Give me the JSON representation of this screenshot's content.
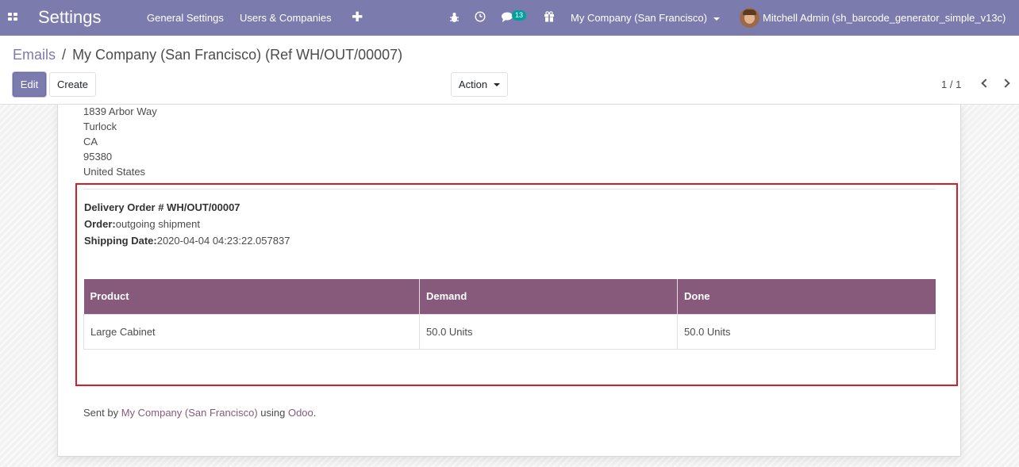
{
  "navbar": {
    "brand": "Settings",
    "menu": [
      "General Settings",
      "Users & Companies"
    ],
    "add_symbol": "✚",
    "message_count": "13",
    "company": "My Company (San Francisco)",
    "user": "Mitchell Admin (sh_barcode_generator_simple_v13c)",
    "icons": [
      "apps-icon",
      "bug-icon",
      "clock-icon",
      "chat-icon",
      "gift-icon"
    ]
  },
  "breadcrumb": {
    "parent": "Emails",
    "separator": "/",
    "current": "My Company (San Francisco) (Ref WH/OUT/00007)"
  },
  "controls": {
    "edit": "Edit",
    "create": "Create",
    "action": "Action",
    "pager": "1 / 1"
  },
  "address": [
    "1839 Arbor Way",
    "Turlock",
    "CA",
    "95380",
    "United States"
  ],
  "delivery": {
    "title": "Delivery Order # WH/OUT/00007",
    "order_label": "Order:",
    "order_value": "outgoing shipment",
    "date_label": "Shipping Date:",
    "date_value": "2020-04-04 04:23:22.057837"
  },
  "table": {
    "headers": [
      "Product",
      "Demand",
      "Done"
    ],
    "rows": [
      [
        "Large Cabinet",
        "50.0 Units",
        "50.0 Units"
      ]
    ]
  },
  "footer": {
    "prefix": "Sent by ",
    "company_link": "My Company (San Francisco)",
    "middle": " using ",
    "odoo_link": "Odoo",
    "suffix": "."
  },
  "colors": {
    "navbar": "#7c7bad",
    "table_header": "#875a7b",
    "highlight": "#d51f26",
    "badge": "#00a09d"
  }
}
